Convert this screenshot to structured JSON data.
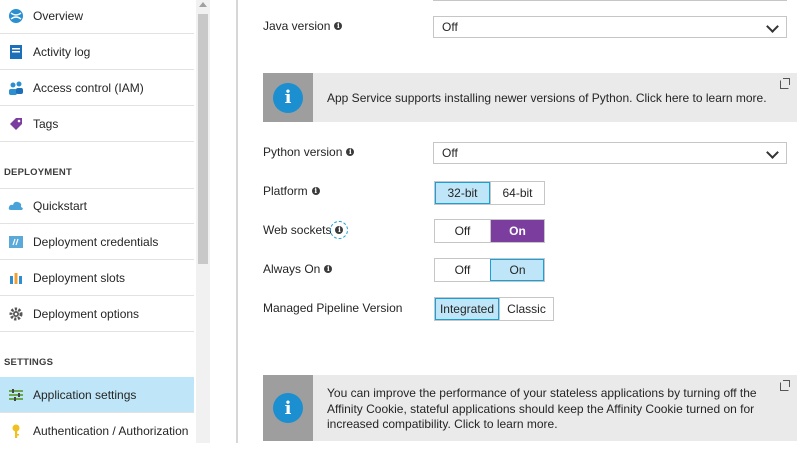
{
  "sidebar": {
    "items": [
      {
        "label": "Overview",
        "icon": "overview-globe-icon",
        "section": null
      },
      {
        "label": "Activity log",
        "icon": "activity-log-icon"
      },
      {
        "label": "Access control (IAM)",
        "icon": "people-icon"
      },
      {
        "label": "Tags",
        "icon": "tag-icon"
      },
      {
        "label": "Quickstart",
        "icon": "cloud-icon"
      },
      {
        "label": "Deployment credentials",
        "icon": "credentials-icon"
      },
      {
        "label": "Deployment slots",
        "icon": "slots-icon"
      },
      {
        "label": "Deployment options",
        "icon": "gear-icon"
      },
      {
        "label": "Application settings",
        "icon": "settings-lines-icon",
        "active": true
      },
      {
        "label": "Authentication / Authorization",
        "icon": "key-icon"
      }
    ],
    "sections": {
      "deployment": "DEPLOYMENT",
      "settings": "SETTINGS"
    }
  },
  "main": {
    "java_version": {
      "label": "Java version",
      "value": "Off"
    },
    "python_banner": {
      "text": "App Service supports installing newer versions of Python. Click here to learn more."
    },
    "python_version": {
      "label": "Python version",
      "value": "Off"
    },
    "platform": {
      "label": "Platform",
      "options": [
        "32-bit",
        "64-bit"
      ],
      "selected": "32-bit"
    },
    "web_sockets": {
      "label": "Web sockets",
      "options": [
        "Off",
        "On"
      ],
      "selected": "On"
    },
    "always_on": {
      "label": "Always On",
      "options": [
        "Off",
        "On"
      ],
      "selected": "On"
    },
    "pipeline": {
      "label": "Managed Pipeline Version",
      "options": [
        "Integrated",
        "Classic"
      ],
      "selected": "Integrated"
    },
    "affinity_banner": {
      "lines": [
        "You can improve the performance of your stateless applications by turning off the",
        "Affinity Cookie, stateful applications should keep the Affinity Cookie turned on for",
        "increased compatibility. Click to learn more."
      ]
    }
  },
  "colors": {
    "accent_blue": "#1aa0d8",
    "selected_bg": "#bfe6f8",
    "on_purple": "#7b3e9e",
    "info_blue": "#1b8fd0"
  }
}
